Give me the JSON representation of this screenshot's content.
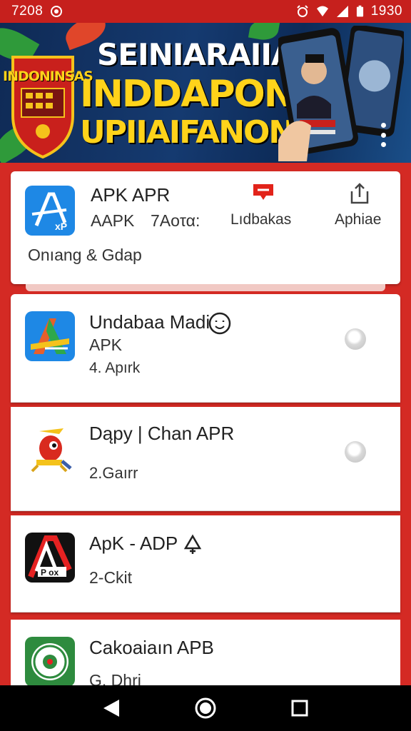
{
  "status_bar": {
    "left_time": "7208",
    "right_time": "1930",
    "icons": [
      "record-icon",
      "alarm-icon",
      "wifi-icon",
      "signal-icon",
      "battery-icon"
    ]
  },
  "banner": {
    "line1": "SEINIARAIIA",
    "line2": "INDDAPONIA",
    "line3": "UPIIAIFANONA",
    "shield_text": "INDONINSAS",
    "menu_icon": "more-vert-icon"
  },
  "featured": {
    "name": "APK APR",
    "sub1": "AAPK",
    "sub2": "7Aoτα:",
    "category": "Onıang & Gdap",
    "action1_label": "Lıdbakas",
    "action1_icon": "red-flag-icon",
    "action2_label": "Aphiae",
    "action2_icon": "share-icon"
  },
  "list": [
    {
      "name": "Undabaa Madi",
      "sub1": "APK",
      "sub2": "4. Apırk",
      "badge_icon": "smile-icon",
      "icon": "apk-logo-icon"
    },
    {
      "name": "Dąpy | Chan APR",
      "sub1": "",
      "sub2": "2.Gaırr",
      "icon": "mascot-icon"
    },
    {
      "name": "ApK - ADP",
      "sub1": "",
      "sub2": "2-Ckit",
      "badge_icon": "bell-icon",
      "icon": "a-black-red-icon"
    },
    {
      "name": "Cakoaiaın APB",
      "sub1": "",
      "sub2": "G. Dhri",
      "icon": "green-emblem-icon"
    }
  ],
  "colors": {
    "primary": "#d42a24",
    "status": "#c6201d",
    "banner_yellow": "#ffd31a"
  }
}
